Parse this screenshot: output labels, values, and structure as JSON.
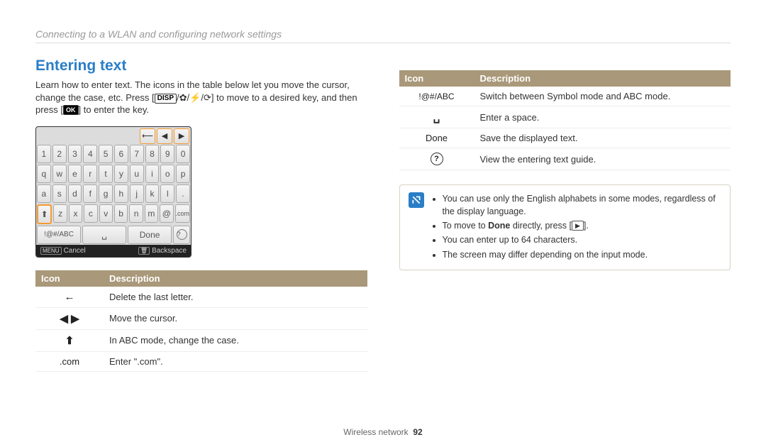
{
  "breadcrumb": "Connecting to a WLAN and configuring network settings",
  "section_title": "Entering text",
  "intro_parts": {
    "p1": "Learn how to enter text. The icons in the table below let you move the cursor, change the case, etc. Press [",
    "disp": "DISP",
    "p2": "/",
    "p3": "/",
    "p4": "/",
    "p5": "] to move to a desired key, and then press [",
    "ok": "OK",
    "p6": "] to enter the key."
  },
  "keyboard": {
    "row1": [
      "1",
      "2",
      "3",
      "4",
      "5",
      "6",
      "7",
      "8",
      "9",
      "0"
    ],
    "row2": [
      "q",
      "w",
      "e",
      "r",
      "t",
      "y",
      "u",
      "i",
      "o",
      "p"
    ],
    "row3": [
      "a",
      "s",
      "d",
      "f",
      "g",
      "h",
      "j",
      "k",
      "l",
      "."
    ],
    "row4_shift_icon": "⬆",
    "row4": [
      "z",
      "x",
      "c",
      "v",
      "b",
      "n",
      "m",
      "@"
    ],
    "row4_com": ".com",
    "row5": {
      "mode": "!@#/ABC",
      "space": "␣",
      "done": "Done",
      "help": "?"
    },
    "top_icons": [
      "⟵",
      "◀",
      "▶"
    ],
    "bottom_left_chip": "MENU",
    "bottom_left": "Cancel",
    "bottom_right_chip": "🗑",
    "bottom_right": "Backspace"
  },
  "table_left": {
    "head_icon": "Icon",
    "head_desc": "Description",
    "rows": [
      {
        "icon": "←",
        "desc": "Delete the last letter."
      },
      {
        "icon": "◀  ▶",
        "desc": "Move the cursor."
      },
      {
        "icon": "⬆",
        "desc": "In ABC mode, change the case."
      },
      {
        "icon": ".com",
        "desc": "Enter \".com\"."
      }
    ]
  },
  "table_right": {
    "head_icon": "Icon",
    "head_desc": "Description",
    "rows": [
      {
        "icon": "!@#/ABC",
        "desc": "Switch between Symbol mode and ABC mode."
      },
      {
        "icon": "␣",
        "desc": "Enter a space."
      },
      {
        "icon": "Done",
        "desc": "Save the displayed text."
      },
      {
        "icon": "?",
        "desc": "View the entering text guide."
      }
    ]
  },
  "notes": {
    "n1": "You can use only the English alphabets in some modes, regardless of the display language.",
    "n2a": "To move to ",
    "n2b": "Done",
    "n2c": " directly, press [",
    "n2d": "].",
    "n3": "You can enter up to 64 characters.",
    "n4": "The screen may differ depending on the input mode."
  },
  "footer": {
    "label": "Wireless network",
    "page": "92"
  }
}
